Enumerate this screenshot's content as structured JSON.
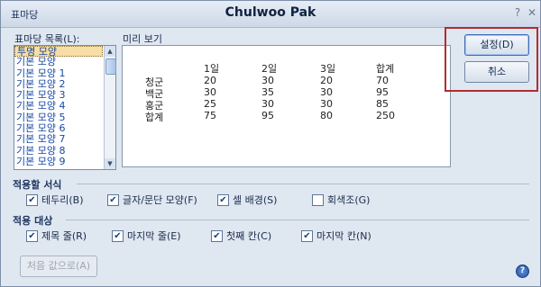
{
  "window": {
    "small_title": "표마당",
    "title": "Chulwoo Pak",
    "help_glyph": "?",
    "close_glyph": "✕"
  },
  "list": {
    "label": "표마당 목록(L):",
    "items": [
      "투명 모양",
      "기본 모양",
      "기본 모양 1",
      "기본 모양 2",
      "기본 모양 3",
      "기본 모양 4",
      "기본 모양 5",
      "기본 모양 6",
      "기본 모양 7",
      "기본 모양 8",
      "기본 모양 9"
    ],
    "selected_index": 0
  },
  "preview": {
    "label": "미리 보기",
    "headers": [
      "1일",
      "2일",
      "3일",
      "합계"
    ],
    "rows": [
      {
        "name": "청군",
        "values": [
          "20",
          "30",
          "20",
          "70"
        ]
      },
      {
        "name": "백군",
        "values": [
          "30",
          "35",
          "30",
          "95"
        ]
      },
      {
        "name": "홍군",
        "values": [
          "25",
          "30",
          "30",
          "85"
        ]
      },
      {
        "name": "합계",
        "values": [
          "75",
          "95",
          "80",
          "250"
        ]
      }
    ]
  },
  "buttons": {
    "ok": "설정(D)",
    "cancel": "취소",
    "reset": "처음 값으로(A)"
  },
  "apply_format": {
    "title": "적용할 서식",
    "options": [
      {
        "label": "테두리(B)",
        "checked": true
      },
      {
        "label": "글자/문단 모양(F)",
        "checked": true
      },
      {
        "label": "셀 배경(S)",
        "checked": true
      },
      {
        "label": "회색조(G)",
        "checked": false
      }
    ]
  },
  "apply_target": {
    "title": "적용 대상",
    "options": [
      {
        "label": "제목 줄(R)",
        "checked": true
      },
      {
        "label": "마지막 줄(E)",
        "checked": true
      },
      {
        "label": "첫째 칸(C)",
        "checked": true
      },
      {
        "label": "마지막 칸(N)",
        "checked": true
      }
    ]
  },
  "colors": {
    "highlight": "#b32d2d",
    "selected_item_bg": "#f6dea5",
    "list_text": "#1747a4"
  }
}
